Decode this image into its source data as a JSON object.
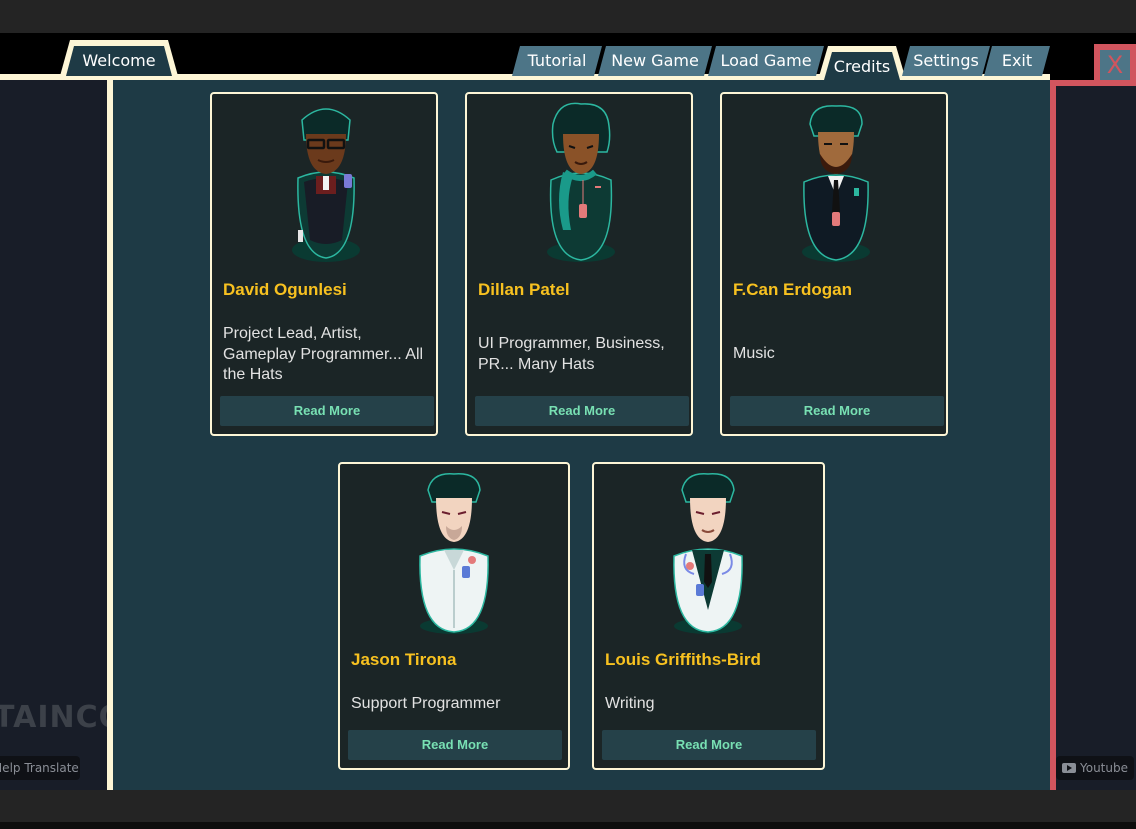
{
  "tabs": {
    "welcome": "Welcome",
    "tutorial": "Tutorial",
    "new_game": "New Game",
    "load_game": "Load Game",
    "credits": "Credits",
    "settings": "Settings",
    "exit": "Exit"
  },
  "close_label": "X",
  "background": {
    "logo_text": "TAINCO",
    "help_translate": "Help Translate",
    "youtube": "Youtube"
  },
  "credits": [
    {
      "name": "David Ogunlesi",
      "role": "Project Lead, Artist, Gameplay Programmer... All the Hats",
      "button": "Read More"
    },
    {
      "name": "Dillan Patel",
      "role": "UI Programmer, Business, PR... Many Hats",
      "button": "Read More"
    },
    {
      "name": "F.Can Erdogan",
      "role": "Music",
      "button": "Read More"
    },
    {
      "name": "Jason Tirona",
      "role": "Support Programmer",
      "button": "Read More"
    },
    {
      "name": "Louis Griffiths-Bird",
      "role": "Writing",
      "button": "Read More"
    }
  ],
  "colors": {
    "panel": "#1e3a45",
    "card": "#1b2526",
    "cream": "#fdf6d6",
    "name": "#f7c120",
    "button_text": "#78e0b3",
    "close": "#d1555e",
    "tab": "#4d7587"
  }
}
